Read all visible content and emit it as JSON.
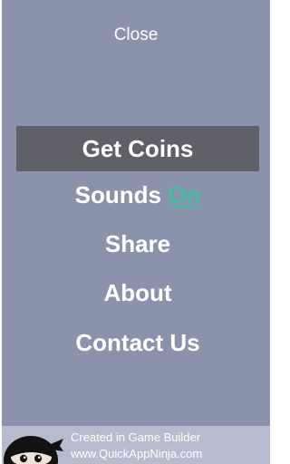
{
  "menu": {
    "close_label": "Close",
    "items": [
      {
        "id": "get-coins",
        "label": "Get Coins",
        "selected": true
      },
      {
        "id": "sounds",
        "label": "Sounds",
        "state": "On"
      },
      {
        "id": "share",
        "label": "Share"
      },
      {
        "id": "about",
        "label": "About"
      },
      {
        "id": "contact-us",
        "label": "Contact Us"
      }
    ]
  },
  "footer": {
    "line1": "Created in Game Builder",
    "line2": "www.QuickAppNinja.com",
    "logo_icon": "ninja-mascot-icon"
  },
  "colors": {
    "panel": "#8b92ac",
    "selected_item": "#5f6068",
    "sound_on": "#3ec1a0",
    "footer": "#b6bcce",
    "text": "#ffffff"
  }
}
